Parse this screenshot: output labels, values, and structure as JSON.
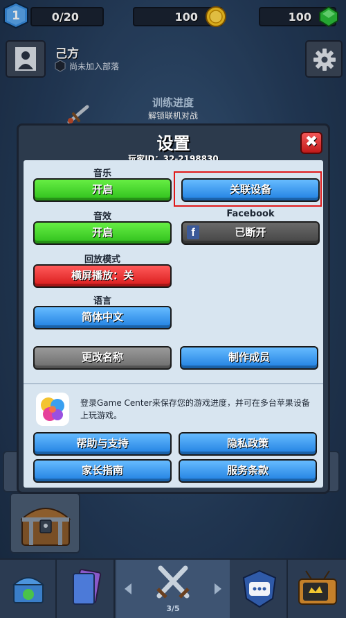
{
  "hud": {
    "level": "1",
    "trophies": "0/20",
    "gold": "100",
    "gems": "100"
  },
  "profile": {
    "name": "己方",
    "clan_status": "尚未加入部落"
  },
  "training": {
    "title": "训练进度",
    "subtitle": "解锁联机对战"
  },
  "settings": {
    "title": "设置",
    "player_id": "玩家ID：32-2198830",
    "close_label": "✖",
    "music_label": "音乐",
    "music_button": "开启",
    "link_device_button": "关联设备",
    "sound_label": "音效",
    "sound_button": "开启",
    "facebook_label": "Facebook",
    "facebook_button": "已断开",
    "replay_label": "回放模式",
    "replay_button": "横屏播放：关",
    "language_label": "语言",
    "language_button": "简体中文",
    "rename_button": "更改名称",
    "credits_button": "制作成员",
    "game_center_text": "登录Game Center来保存您的游戏进度，并可在多台苹果设备上玩游戏。",
    "help_button": "帮助与支持",
    "privacy_button": "隐私政策",
    "parents_button": "家长指南",
    "terms_button": "服务条款"
  },
  "nav": {
    "page_indicator": "3/5"
  },
  "colors": {
    "green_button": "#2fbf1c",
    "blue_button": "#1f7fe0",
    "red_button": "#d81a1a",
    "gray_button": "#6c6c6c",
    "highlight_box": "#e01818",
    "panel": "#d8e5f0"
  }
}
